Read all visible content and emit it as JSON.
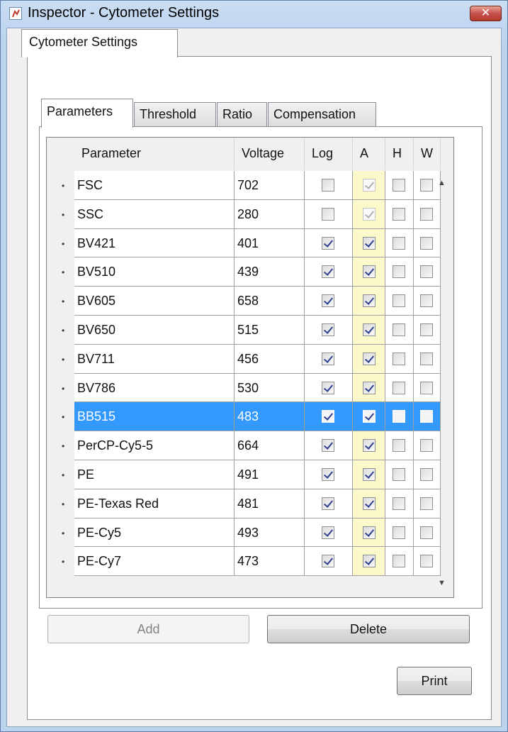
{
  "window": {
    "title": "Inspector - Cytometer Settings",
    "close_label": "✕"
  },
  "outer_tab": {
    "label": "Cytometer Settings"
  },
  "inner_tabs": [
    {
      "label": "Parameters",
      "active": true
    },
    {
      "label": "Threshold",
      "active": false
    },
    {
      "label": "Ratio",
      "active": false
    },
    {
      "label": "Compensation",
      "active": false
    }
  ],
  "grid": {
    "columns": [
      "Parameter",
      "Voltage",
      "Log",
      "A",
      "H",
      "W"
    ],
    "rows": [
      {
        "parameter": "FSC",
        "voltage": "702",
        "log": false,
        "a": true,
        "a_disabled": true,
        "h": false,
        "w": false,
        "selected": false
      },
      {
        "parameter": "SSC",
        "voltage": "280",
        "log": false,
        "a": true,
        "a_disabled": true,
        "h": false,
        "w": false,
        "selected": false
      },
      {
        "parameter": "BV421",
        "voltage": "401",
        "log": true,
        "a": true,
        "a_disabled": false,
        "h": false,
        "w": false,
        "selected": false
      },
      {
        "parameter": "BV510",
        "voltage": "439",
        "log": true,
        "a": true,
        "a_disabled": false,
        "h": false,
        "w": false,
        "selected": false
      },
      {
        "parameter": "BV605",
        "voltage": "658",
        "log": true,
        "a": true,
        "a_disabled": false,
        "h": false,
        "w": false,
        "selected": false
      },
      {
        "parameter": "BV650",
        "voltage": "515",
        "log": true,
        "a": true,
        "a_disabled": false,
        "h": false,
        "w": false,
        "selected": false
      },
      {
        "parameter": "BV711",
        "voltage": "456",
        "log": true,
        "a": true,
        "a_disabled": false,
        "h": false,
        "w": false,
        "selected": false
      },
      {
        "parameter": "BV786",
        "voltage": "530",
        "log": true,
        "a": true,
        "a_disabled": false,
        "h": false,
        "w": false,
        "selected": false
      },
      {
        "parameter": "BB515",
        "voltage": "483",
        "log": true,
        "a": true,
        "a_disabled": false,
        "h": false,
        "w": false,
        "selected": true
      },
      {
        "parameter": "PerCP-Cy5-5",
        "voltage": "664",
        "log": true,
        "a": true,
        "a_disabled": false,
        "h": false,
        "w": false,
        "selected": false
      },
      {
        "parameter": "PE",
        "voltage": "491",
        "log": true,
        "a": true,
        "a_disabled": false,
        "h": false,
        "w": false,
        "selected": false
      },
      {
        "parameter": "PE-Texas Red",
        "voltage": "481",
        "log": true,
        "a": true,
        "a_disabled": false,
        "h": false,
        "w": false,
        "selected": false
      },
      {
        "parameter": "PE-Cy5",
        "voltage": "493",
        "log": true,
        "a": true,
        "a_disabled": false,
        "h": false,
        "w": false,
        "selected": false
      },
      {
        "parameter": "PE-Cy7",
        "voltage": "473",
        "log": true,
        "a": true,
        "a_disabled": false,
        "h": false,
        "w": false,
        "selected": false
      }
    ],
    "row_marker": "•",
    "scroll_up_icon": "▲",
    "scroll_down_icon": "▼"
  },
  "buttons": {
    "add": "Add",
    "delete": "Delete",
    "print": "Print"
  },
  "colors": {
    "selection": "#3399ff",
    "a_column": "#fbf8c9"
  }
}
